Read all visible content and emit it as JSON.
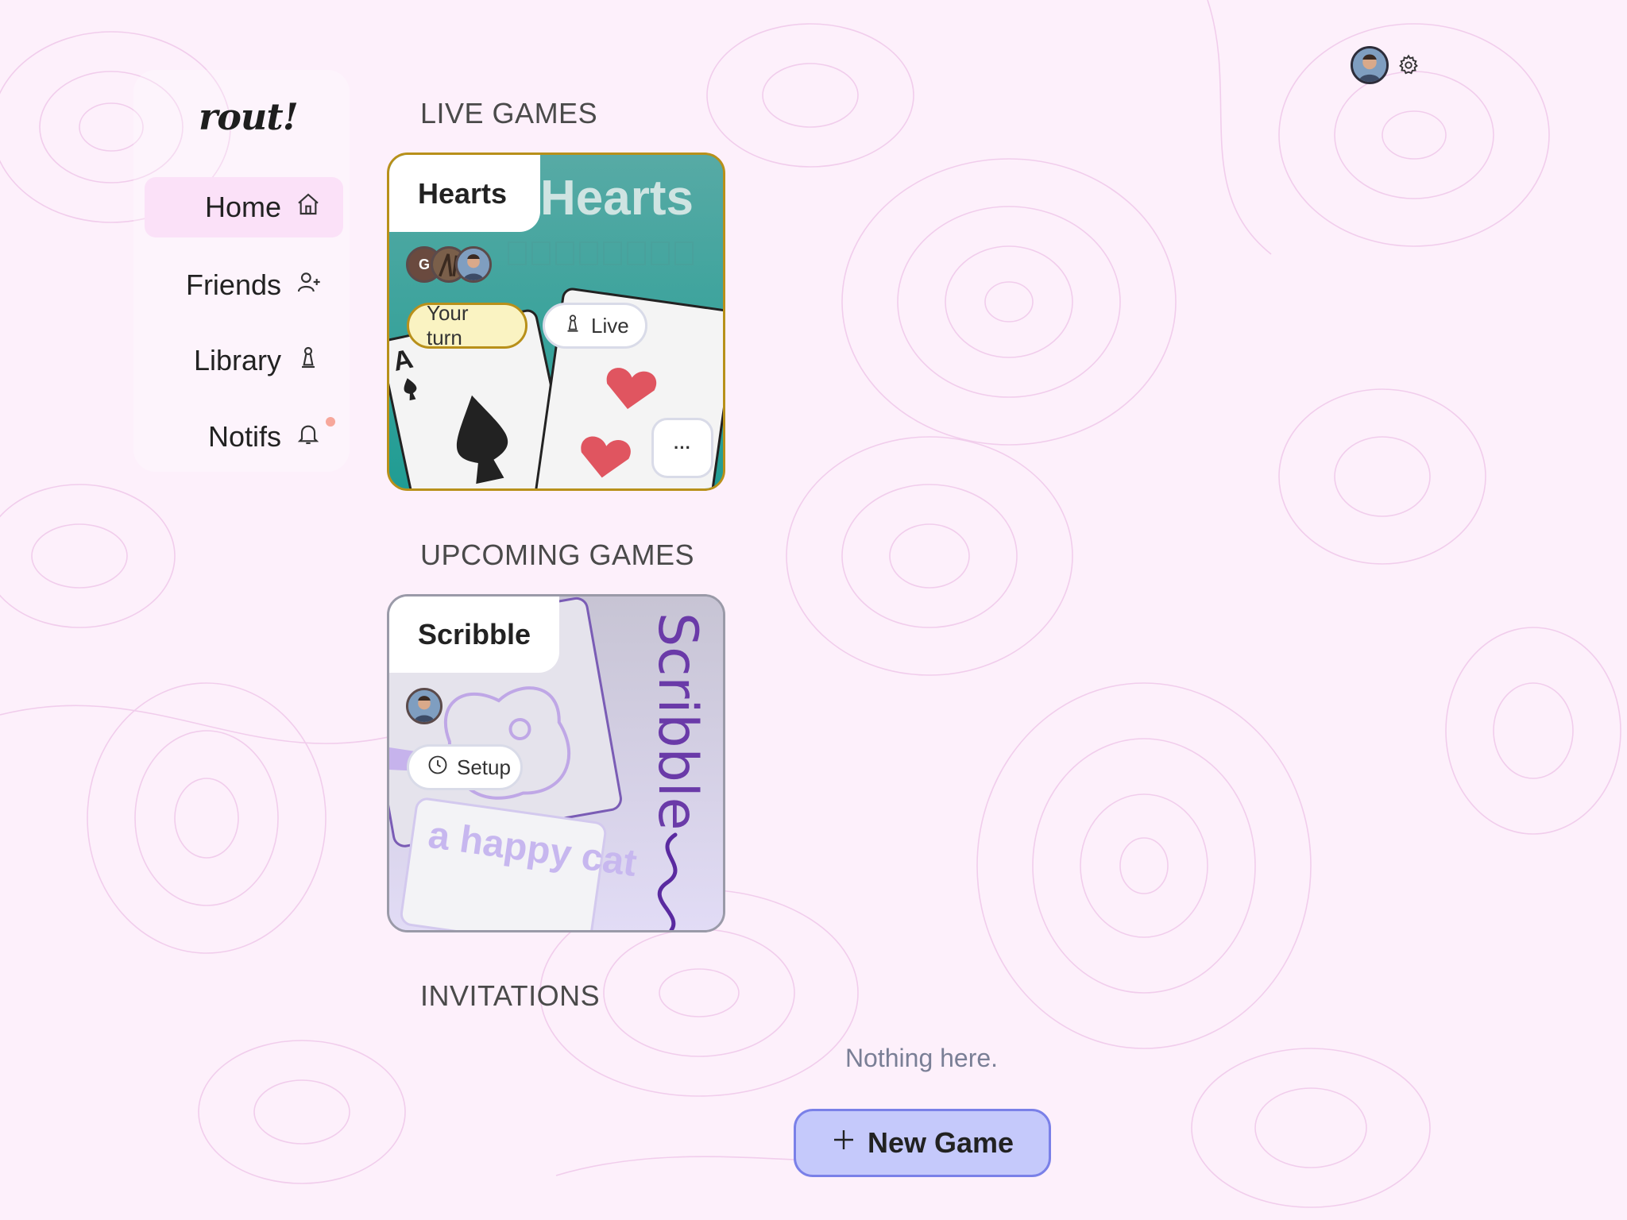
{
  "app": {
    "logo": "rout!"
  },
  "nav": [
    {
      "label": "Home",
      "icon": "home-icon",
      "active": true
    },
    {
      "label": "Friends",
      "icon": "add-friend-icon"
    },
    {
      "label": "Library",
      "icon": "pawn-icon"
    },
    {
      "label": "Notifs",
      "icon": "bell-icon",
      "has_unread": true
    }
  ],
  "header": {
    "avatar": "user-avatar",
    "settings_icon": "gear-icon"
  },
  "sections": {
    "live": "LIVE GAMES",
    "upcoming": "UPCOMING GAMES",
    "invitations": "INVITATIONS"
  },
  "live_game": {
    "title": "Hearts",
    "art_title": "Hearts",
    "avatar_initial": "G",
    "turn_label": "Your turn",
    "status_label": "Live",
    "more_label": "···",
    "accent": "#b8901a",
    "art_bg": "#3a9a97"
  },
  "upcoming_game": {
    "title": "Scribble",
    "art_title": "Scribble",
    "status_label": "Setup",
    "prompt": "a happy cat",
    "art_bg": "#c9c3e2"
  },
  "invitations": {
    "empty_text": "Nothing here."
  },
  "actions": {
    "new_game": "New Game"
  }
}
